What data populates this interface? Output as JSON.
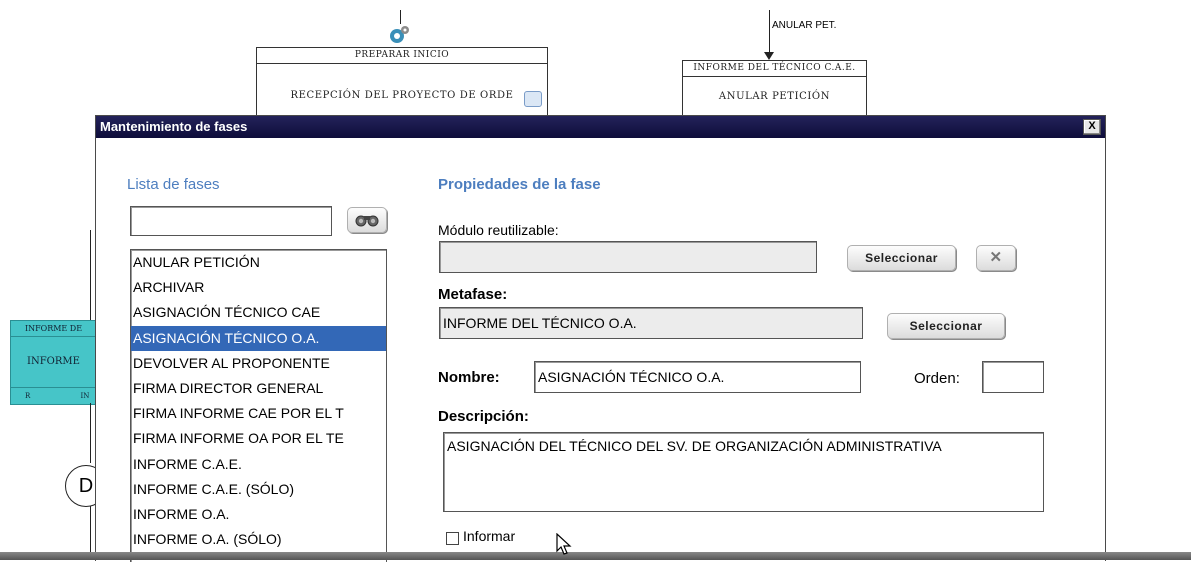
{
  "canvas": {
    "node_preparar_header": "PREPARAR INICIO",
    "node_preparar_body": "RECEPCIÓN DEL PROYECTO DE ORDE",
    "node_informe_header": "INFORME DEL TÉCNICO C.A.E.",
    "node_informe_body": "ANULAR PETICIÓN",
    "anular_label": "ANULAR PET.",
    "teal_header": "INFORME DE",
    "teal_body": "INFORME",
    "teal_foot_a": "R",
    "teal_foot_b": "IN",
    "circle_letter": "D"
  },
  "dialog": {
    "title": "Mantenimiento de fases",
    "close_glyph": "X",
    "list_heading": "Lista de fases",
    "search_value": "",
    "phases": [
      "ANULAR PETICIÓN",
      "ARCHIVAR",
      "ASIGNACIÓN TÉCNICO CAE",
      "ASIGNACIÓN TÉCNICO O.A.",
      "DEVOLVER AL PROPONENTE",
      "FIRMA DIRECTOR GENERAL",
      "FIRMA INFORME CAE POR EL T",
      "FIRMA INFORME OA POR EL TE",
      "INFORME C.A.E.",
      "INFORME C.A.E. (SÓLO)",
      "INFORME O.A.",
      "INFORME O.A. (SÓLO)"
    ],
    "selected_phase_index": 3,
    "props_heading": "Propiedades de la fase",
    "modulo_label": "Módulo reutilizable:",
    "modulo_value": "",
    "seleccionar_label": "Seleccionar",
    "clear_glyph": "✕",
    "metafase_label": "Metafase:",
    "metafase_value": "INFORME DEL TÉCNICO O.A.",
    "nombre_label": "Nombre:",
    "nombre_value": "ASIGNACIÓN TÉCNICO O.A.",
    "orden_label": "Orden:",
    "orden_value": "",
    "descripcion_label": "Descripción:",
    "descripcion_value": "ASIGNACIÓN DEL TÉCNICO DEL SV. DE ORGANIZACIÓN ADMINISTRATIVA",
    "informar_label": "Informar",
    "informar_checked": false
  }
}
